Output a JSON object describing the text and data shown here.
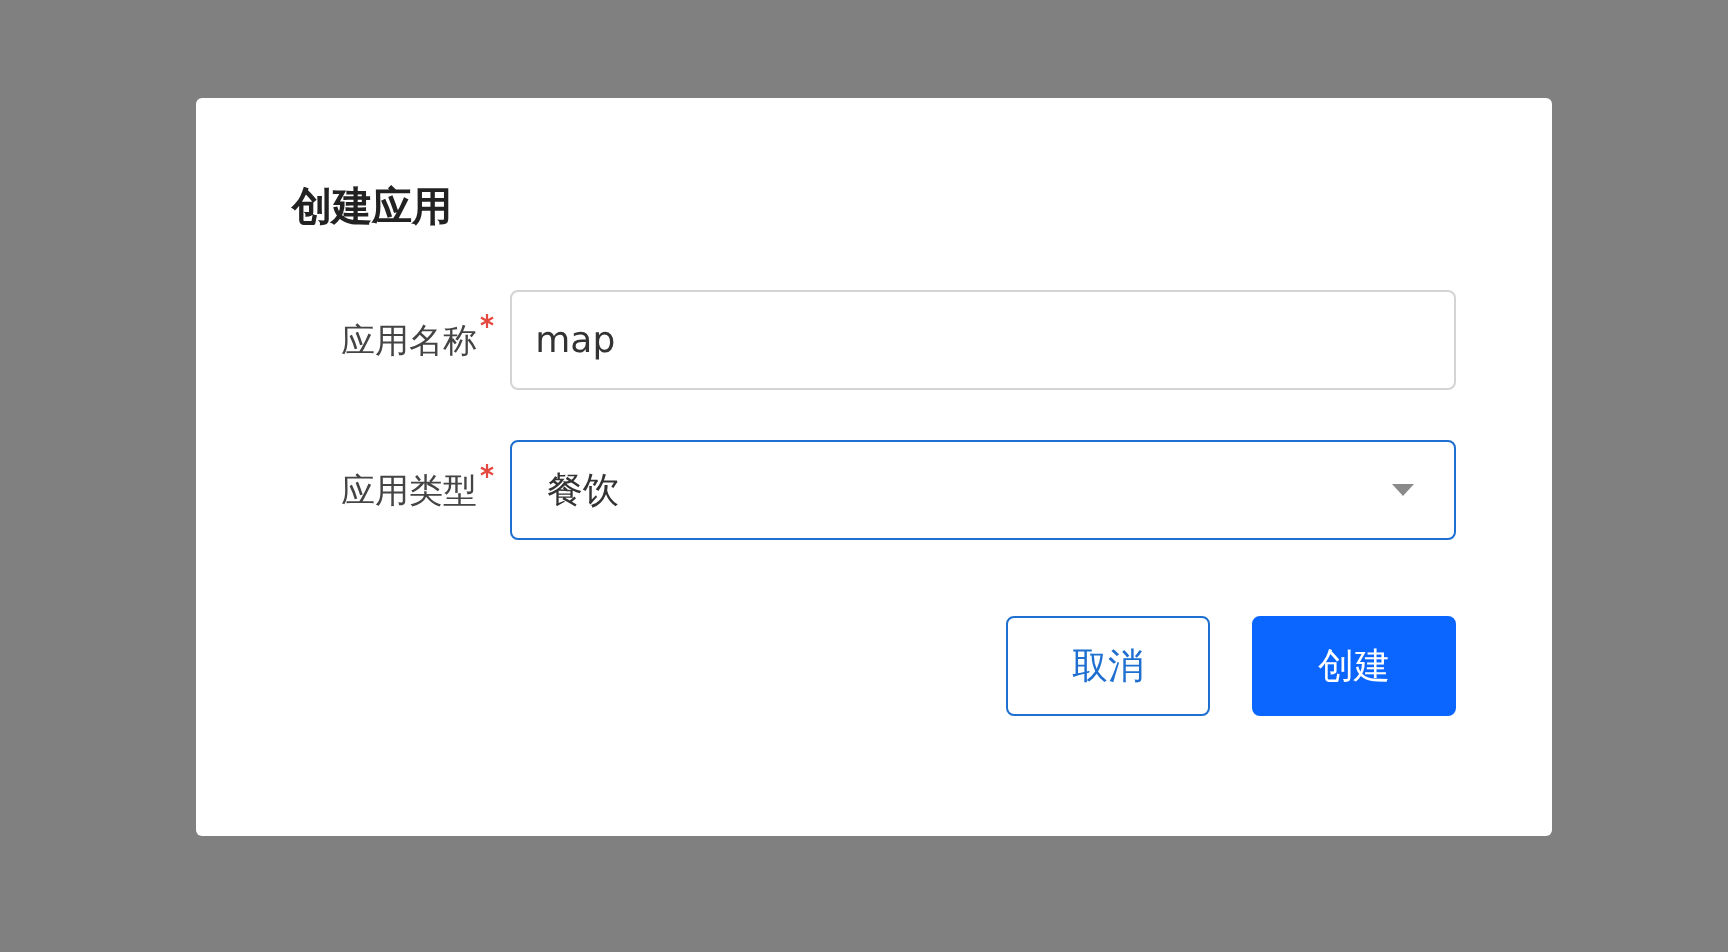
{
  "dialog": {
    "title": "创建应用",
    "fields": [
      {
        "kind": "text",
        "label": "应用名称",
        "required": true,
        "value": "map",
        "focused": false
      },
      {
        "kind": "select",
        "label": "应用类型",
        "required": true,
        "value": "餐饮",
        "focused": true
      }
    ],
    "buttons": [
      {
        "label": "取消",
        "primary": false
      },
      {
        "label": "创建",
        "primary": true
      }
    ]
  }
}
